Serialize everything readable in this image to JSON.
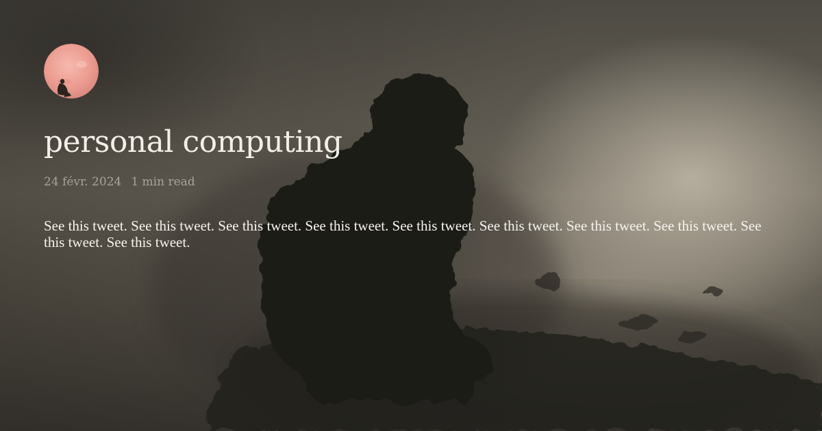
{
  "avatar": {
    "icon": "thinking-figure-moon-avatar",
    "accent": "#f0a9a0"
  },
  "post": {
    "title": "personal computing",
    "date": "24 févr. 2024",
    "reading_time": "1 min read",
    "excerpt": "See this tweet. See this tweet. See this tweet. See this tweet. See this tweet. See this tweet. See this tweet. See this tweet. See this tweet. See this tweet."
  },
  "background": {
    "subject": "thinking-figure-silhouette",
    "base_color": "#4a4740"
  }
}
